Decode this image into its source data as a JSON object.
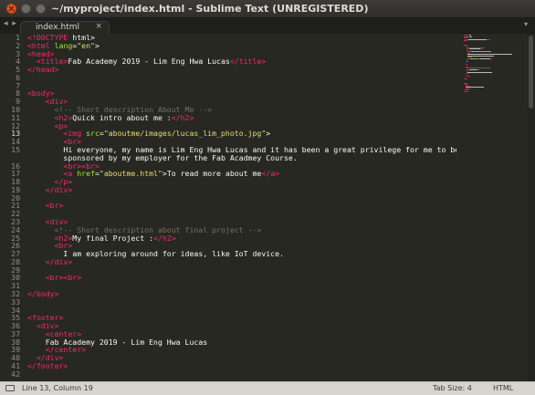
{
  "window": {
    "title": "~/myproject/index.html - Sublime Text (UNREGISTERED)",
    "icons": [
      "close-icon",
      "minimize-icon",
      "maximize-icon"
    ]
  },
  "tabbar": {
    "nav_arrows": "◂ ▸",
    "tab": {
      "label": "index.html",
      "close": "×"
    },
    "dropdown": "▾"
  },
  "editor": {
    "active_line": 13,
    "lines": [
      {
        "n": "1",
        "segs": [
          [
            "t",
            "<!DOCTYPE"
          ],
          [
            "",
            ""
          ],
          [
            "",
            ""
          ],
          [
            "n",
            " html>"
          ]
        ]
      },
      {
        "n": "2",
        "segs": [
          [
            "t",
            "<html"
          ],
          [
            "a",
            " lang"
          ],
          [
            "n",
            "="
          ],
          [
            "s",
            "\"en\""
          ],
          [
            "n",
            ">"
          ]
        ]
      },
      {
        "n": "3",
        "segs": [
          [
            "t",
            "<head>"
          ]
        ]
      },
      {
        "n": "4",
        "segs": [
          [
            "n",
            "  "
          ],
          [
            "t",
            "<title>"
          ],
          [
            "n",
            "Fab Academy 2019 - Lim Eng Hwa Lucas"
          ],
          [
            "t",
            "</title>"
          ]
        ]
      },
      {
        "n": "5",
        "segs": [
          [
            "t",
            "</head>"
          ]
        ]
      },
      {
        "n": "6",
        "segs": []
      },
      {
        "n": "7",
        "segs": []
      },
      {
        "n": "8",
        "segs": [
          [
            "t",
            "<body>"
          ]
        ]
      },
      {
        "n": "9",
        "segs": [
          [
            "n",
            "    "
          ],
          [
            "t",
            "<div>"
          ]
        ]
      },
      {
        "n": "10",
        "segs": [
          [
            "n",
            "      "
          ],
          [
            "c",
            "<!-- Short description About Me -->"
          ]
        ]
      },
      {
        "n": "11",
        "segs": [
          [
            "n",
            "      "
          ],
          [
            "t",
            "<h2>"
          ],
          [
            "n",
            "Quick intro about me :"
          ],
          [
            "t",
            "</h2>"
          ]
        ]
      },
      {
        "n": "12",
        "segs": [
          [
            "n",
            "      "
          ],
          [
            "t",
            "<p>"
          ]
        ]
      },
      {
        "n": "13",
        "segs": [
          [
            "n",
            "        "
          ],
          [
            "t",
            "<img"
          ],
          [
            "a",
            " src"
          ],
          [
            "n",
            "="
          ],
          [
            "s",
            "\"aboutme/images/lucas_lim_photo.jpg\""
          ],
          [
            "n",
            ">"
          ]
        ]
      },
      {
        "n": "14",
        "segs": [
          [
            "n",
            "        "
          ],
          [
            "t",
            "<br>"
          ]
        ]
      },
      {
        "n": "15",
        "segs": [
          [
            "n",
            "        Hi everyone, my name is Lim Eng Hwa Lucas and it has been a great privilege for me to be"
          ]
        ]
      },
      {
        "n": "",
        "segs": [
          [
            "n",
            "        sponsored by my employer for the Fab Acadmey Course."
          ]
        ]
      },
      {
        "n": "16",
        "segs": [
          [
            "n",
            "        "
          ],
          [
            "t",
            "<br><br>"
          ]
        ]
      },
      {
        "n": "17",
        "segs": [
          [
            "n",
            "        "
          ],
          [
            "t",
            "<a"
          ],
          [
            "a",
            " href"
          ],
          [
            "n",
            "="
          ],
          [
            "s",
            "\"aboutme.html\""
          ],
          [
            "n",
            ">To read more about me"
          ],
          [
            "t",
            "</a>"
          ]
        ]
      },
      {
        "n": "18",
        "segs": [
          [
            "n",
            "      "
          ],
          [
            "t",
            "</p>"
          ]
        ]
      },
      {
        "n": "19",
        "segs": [
          [
            "n",
            "    "
          ],
          [
            "t",
            "</div>"
          ]
        ]
      },
      {
        "n": "20",
        "segs": []
      },
      {
        "n": "21",
        "segs": [
          [
            "n",
            "    "
          ],
          [
            "t",
            "<br>"
          ]
        ]
      },
      {
        "n": "22",
        "segs": []
      },
      {
        "n": "23",
        "segs": [
          [
            "n",
            "    "
          ],
          [
            "t",
            "<div>"
          ]
        ]
      },
      {
        "n": "24",
        "segs": [
          [
            "n",
            "      "
          ],
          [
            "c",
            "<!-- Short description about final project -->"
          ]
        ]
      },
      {
        "n": "25",
        "segs": [
          [
            "n",
            "      "
          ],
          [
            "t",
            "<h2>"
          ],
          [
            "n",
            "My final Project :"
          ],
          [
            "t",
            "</h2>"
          ]
        ]
      },
      {
        "n": "26",
        "segs": [
          [
            "n",
            "      "
          ],
          [
            "t",
            "<br>"
          ]
        ]
      },
      {
        "n": "27",
        "segs": [
          [
            "n",
            "        I am exploring around for ideas, like IoT device."
          ]
        ]
      },
      {
        "n": "28",
        "segs": [
          [
            "n",
            "    "
          ],
          [
            "t",
            "</div>"
          ]
        ]
      },
      {
        "n": "29",
        "segs": []
      },
      {
        "n": "30",
        "segs": [
          [
            "n",
            "    "
          ],
          [
            "t",
            "<br><br>"
          ]
        ]
      },
      {
        "n": "31",
        "segs": []
      },
      {
        "n": "32",
        "segs": [
          [
            "t",
            "</body>"
          ]
        ]
      },
      {
        "n": "33",
        "segs": []
      },
      {
        "n": "34",
        "segs": []
      },
      {
        "n": "35",
        "segs": [
          [
            "t",
            "<footer>"
          ]
        ]
      },
      {
        "n": "36",
        "segs": [
          [
            "n",
            "  "
          ],
          [
            "t",
            "<div>"
          ]
        ]
      },
      {
        "n": "37",
        "segs": [
          [
            "n",
            "    "
          ],
          [
            "t",
            "<center>"
          ]
        ]
      },
      {
        "n": "38",
        "segs": [
          [
            "n",
            "    Fab Academy 2019 - Lim Eng Hwa Lucas"
          ]
        ]
      },
      {
        "n": "39",
        "segs": [
          [
            "n",
            "    "
          ],
          [
            "t",
            "</center>"
          ]
        ]
      },
      {
        "n": "40",
        "segs": [
          [
            "n",
            "  "
          ],
          [
            "t",
            "</div>"
          ]
        ]
      },
      {
        "n": "41",
        "segs": [
          [
            "t",
            "</footer>"
          ]
        ]
      },
      {
        "n": "42",
        "segs": []
      }
    ]
  },
  "statusbar": {
    "cursor": "Line 13, Column 19",
    "tab_size": "Tab Size: 4",
    "syntax": "HTML"
  },
  "colors": {
    "background": "#272822",
    "tag": "#f92672",
    "attribute": "#a6e22e",
    "string": "#e6db74",
    "comment": "#75715e",
    "text": "#f8f8f2"
  }
}
